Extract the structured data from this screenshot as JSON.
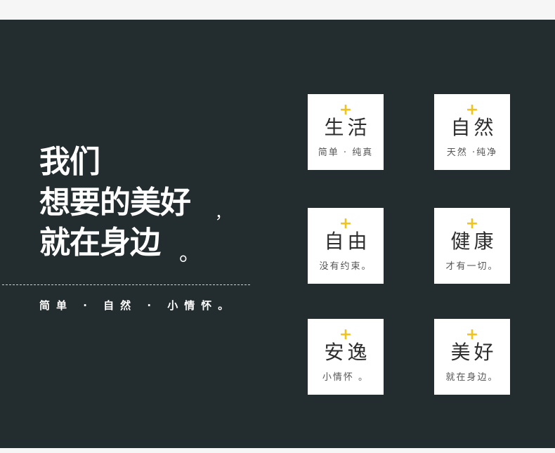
{
  "hero": {
    "line1": "我们",
    "line2": "想要的美好",
    "line2_punct": "，",
    "line3": "就在身边",
    "line3_punct": "。",
    "tagline": "简单 · 自然 · 小情怀。"
  },
  "cards": [
    {
      "plus": "+",
      "title": "生活",
      "subtitle": "简单 · 纯真"
    },
    {
      "plus": "+",
      "title": "自然",
      "subtitle": "天然 ·纯净"
    },
    {
      "plus": "+",
      "title": "自由",
      "subtitle": "没有约束。"
    },
    {
      "plus": "+",
      "title": "健康",
      "subtitle": "才有一切。"
    },
    {
      "plus": "+",
      "title": "安逸",
      "subtitle": "小情怀 。"
    },
    {
      "plus": "+",
      "title": "美好",
      "subtitle": "就在身边。"
    }
  ],
  "colors": {
    "background": "#232d30",
    "accent": "#f0c419",
    "card": "#ffffff"
  }
}
